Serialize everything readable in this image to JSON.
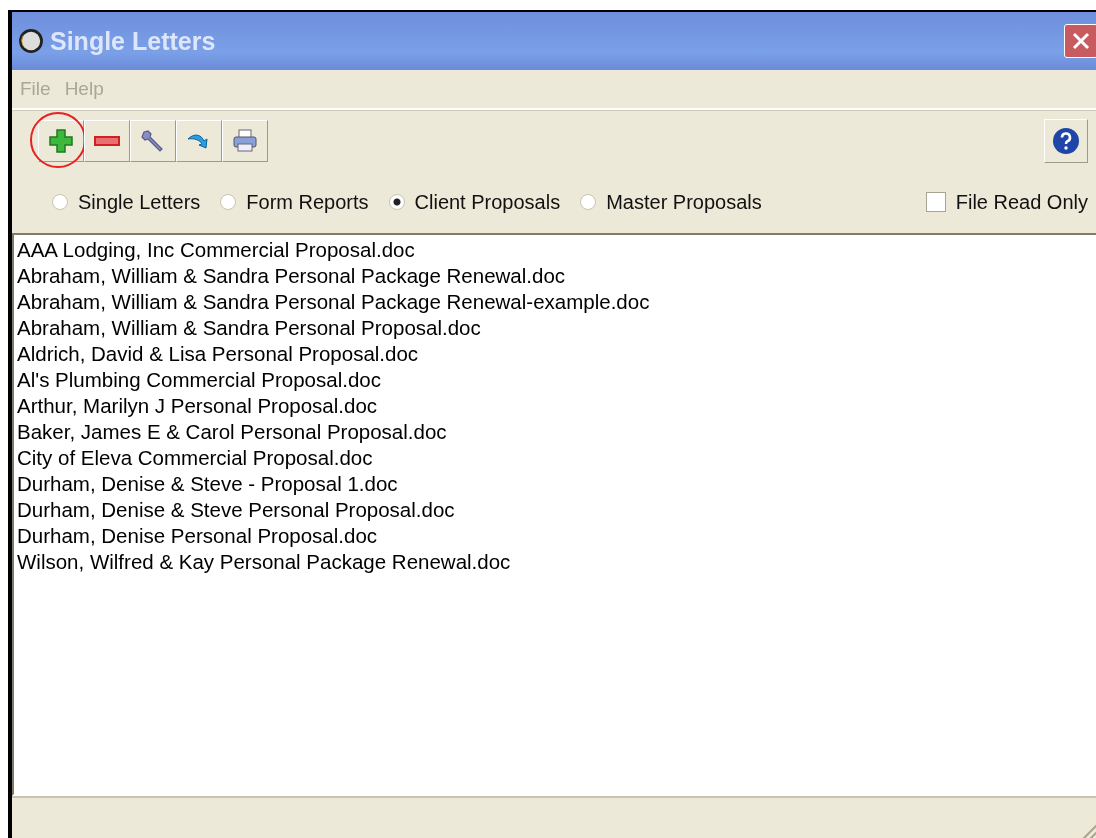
{
  "window": {
    "title": "Single Letters"
  },
  "menu": [
    "File",
    "Help"
  ],
  "toolbar": [
    {
      "kind": "add",
      "highlighted": true
    },
    {
      "kind": "remove",
      "highlighted": false
    },
    {
      "kind": "wrench",
      "highlighted": false
    },
    {
      "kind": "arrow",
      "highlighted": false
    },
    {
      "kind": "print",
      "highlighted": false
    }
  ],
  "options": [
    {
      "label": "Single Letters",
      "selected": false
    },
    {
      "label": "Form Reports",
      "selected": false
    },
    {
      "label": "Client Proposals",
      "selected": true
    },
    {
      "label": "Master Proposals",
      "selected": false
    }
  ],
  "read_only": {
    "label": "File Read Only",
    "checked": false
  },
  "files": [
    "AAA Lodging, Inc Commercial Proposal.doc",
    "Abraham, William & Sandra Personal Package Renewal.doc",
    "Abraham, William & Sandra Personal Package Renewal-example.doc",
    "Abraham, William & Sandra Personal Proposal.doc",
    "Aldrich, David & Lisa Personal Proposal.doc",
    "Al's Plumbing Commercial Proposal.doc",
    "Arthur, Marilyn J Personal Proposal.doc",
    "Baker, James E & Carol Personal Proposal.doc",
    "City of Eleva Commercial Proposal.doc",
    "Durham, Denise & Steve - Proposal 1.doc",
    "Durham, Denise & Steve Personal Proposal.doc",
    "Durham, Denise Personal Proposal.doc",
    "Wilson, Wilfred & Kay Personal Package Renewal.doc"
  ]
}
